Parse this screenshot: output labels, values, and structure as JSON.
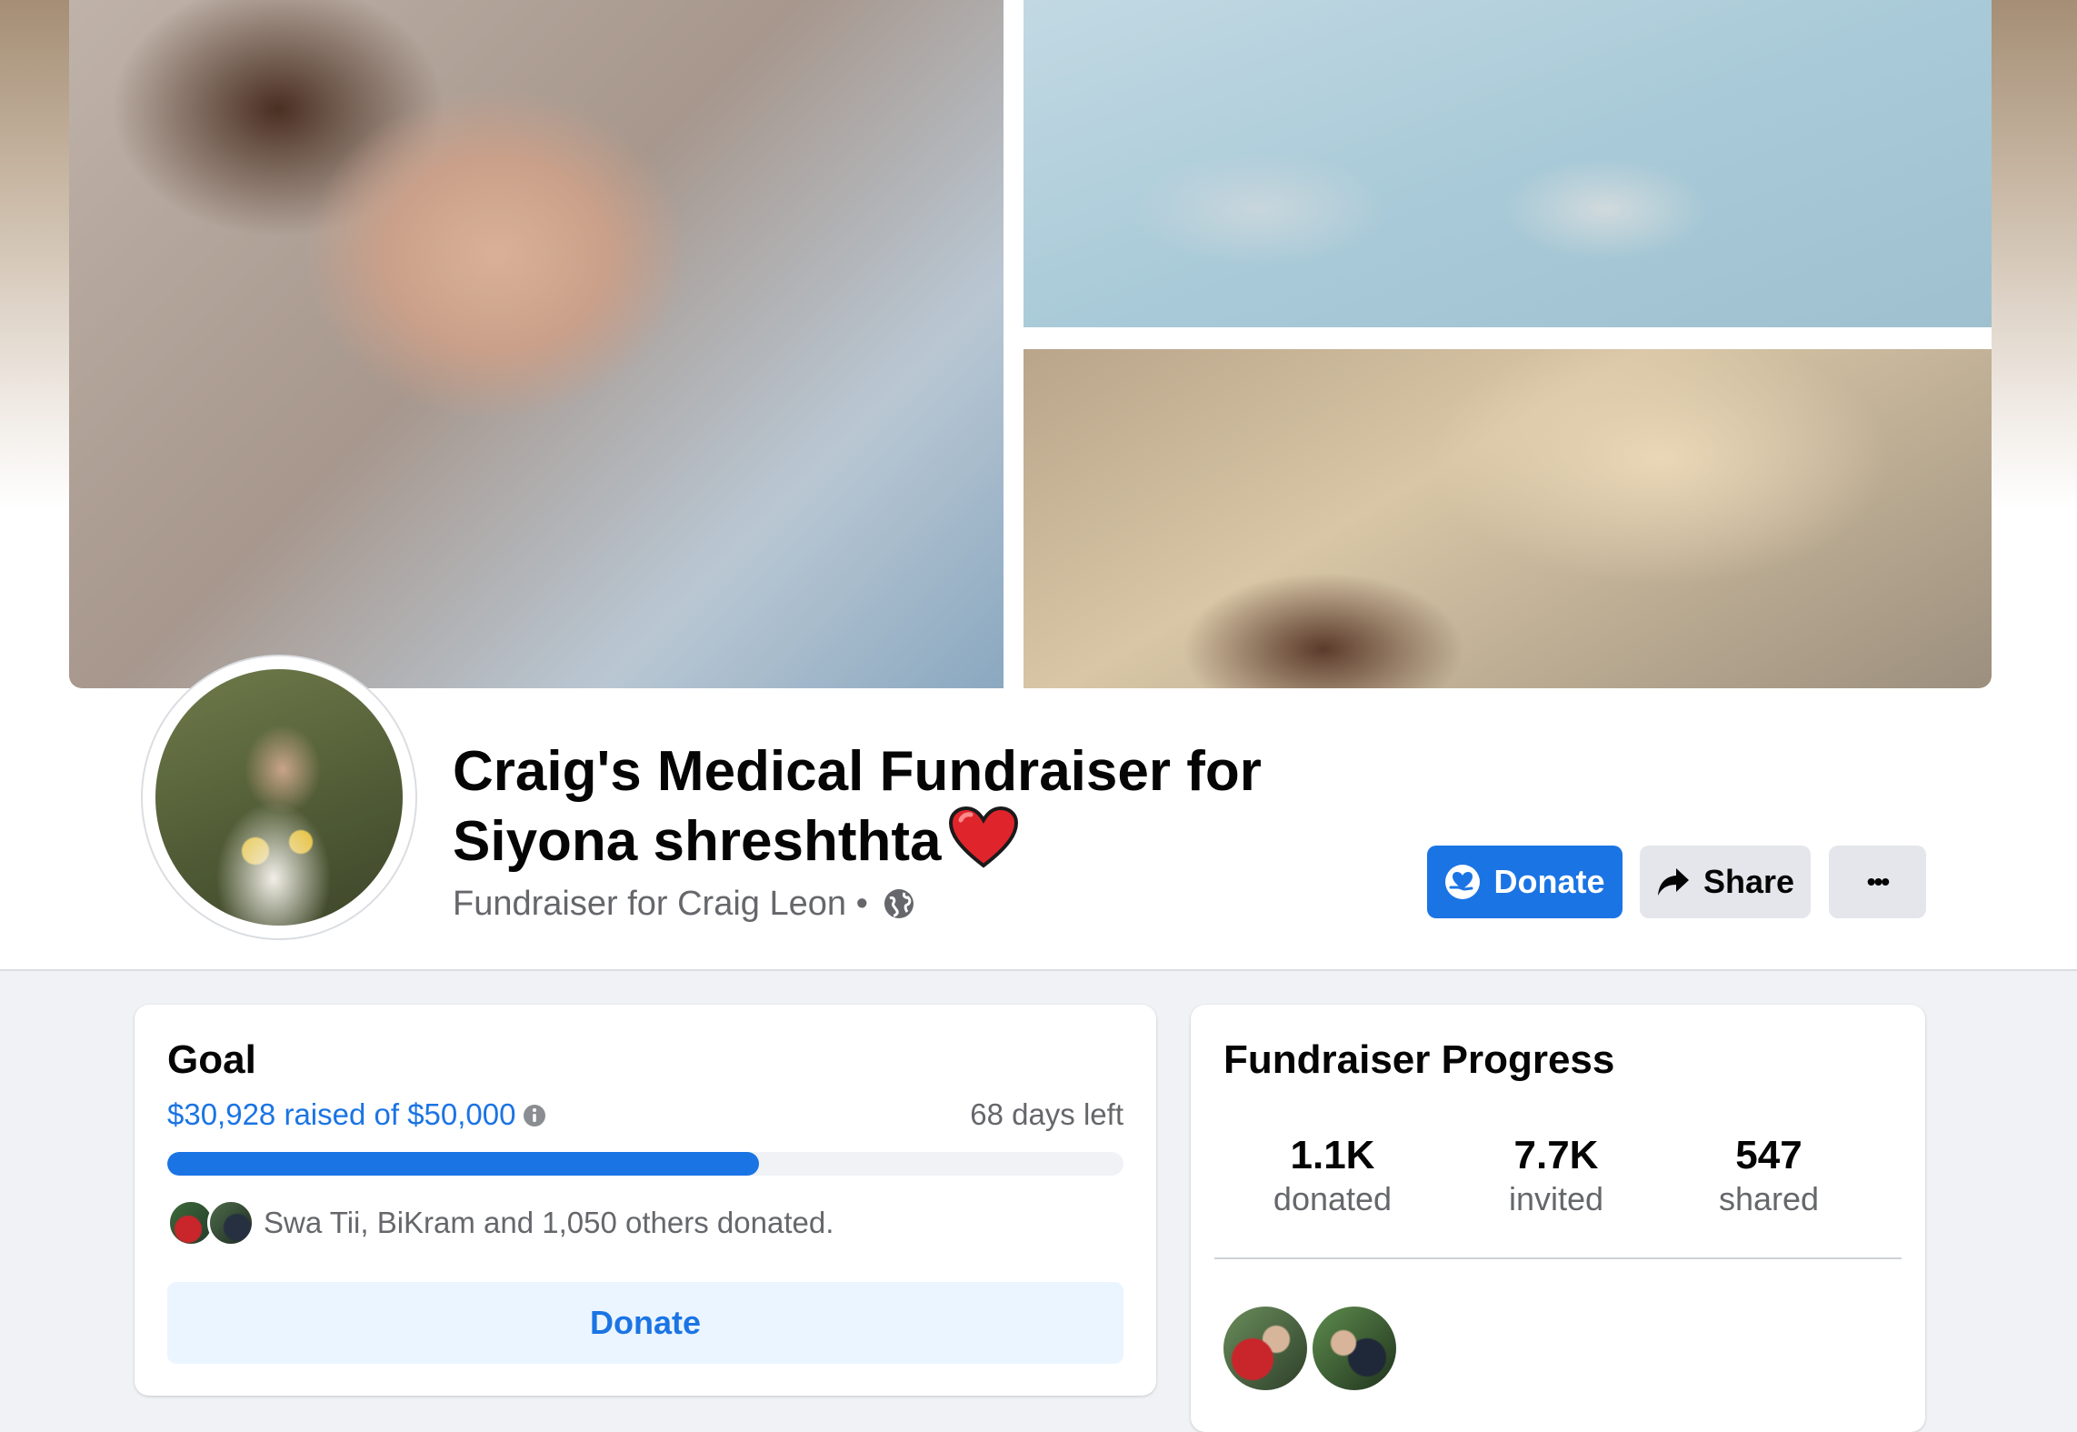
{
  "header": {
    "title_line1": "Craig's Medical Fundraiser for",
    "title_line2": "Siyona shreshthta",
    "subtitle": "Fundraiser for Craig Leon",
    "subtitle_separator": "•",
    "privacy_icon": "globe-icon",
    "heart_icon": "heart-icon"
  },
  "actions": {
    "donate_label": "Donate",
    "share_label": "Share",
    "more_label": "•••"
  },
  "goal": {
    "title": "Goal",
    "raised_text": "$30,928 raised of $50,000",
    "raised_amount": 30928,
    "goal_amount": 50000,
    "progress_fraction": 0.6186,
    "days_left": "68 days left",
    "donors_text": "Swa Tii, BiKram and 1,050 others donated.",
    "donate_label": "Donate"
  },
  "progress": {
    "title": "Fundraiser Progress",
    "stats": [
      {
        "value": "1.1K",
        "label": "donated"
      },
      {
        "value": "7.7K",
        "label": "invited"
      },
      {
        "value": "547",
        "label": "shared"
      }
    ]
  },
  "colors": {
    "accent": "#1b74e4",
    "accent_light": "#ebf5ff",
    "secondary_button": "#e4e6eb",
    "muted_text": "#65676b",
    "background": "#f0f2f5"
  }
}
